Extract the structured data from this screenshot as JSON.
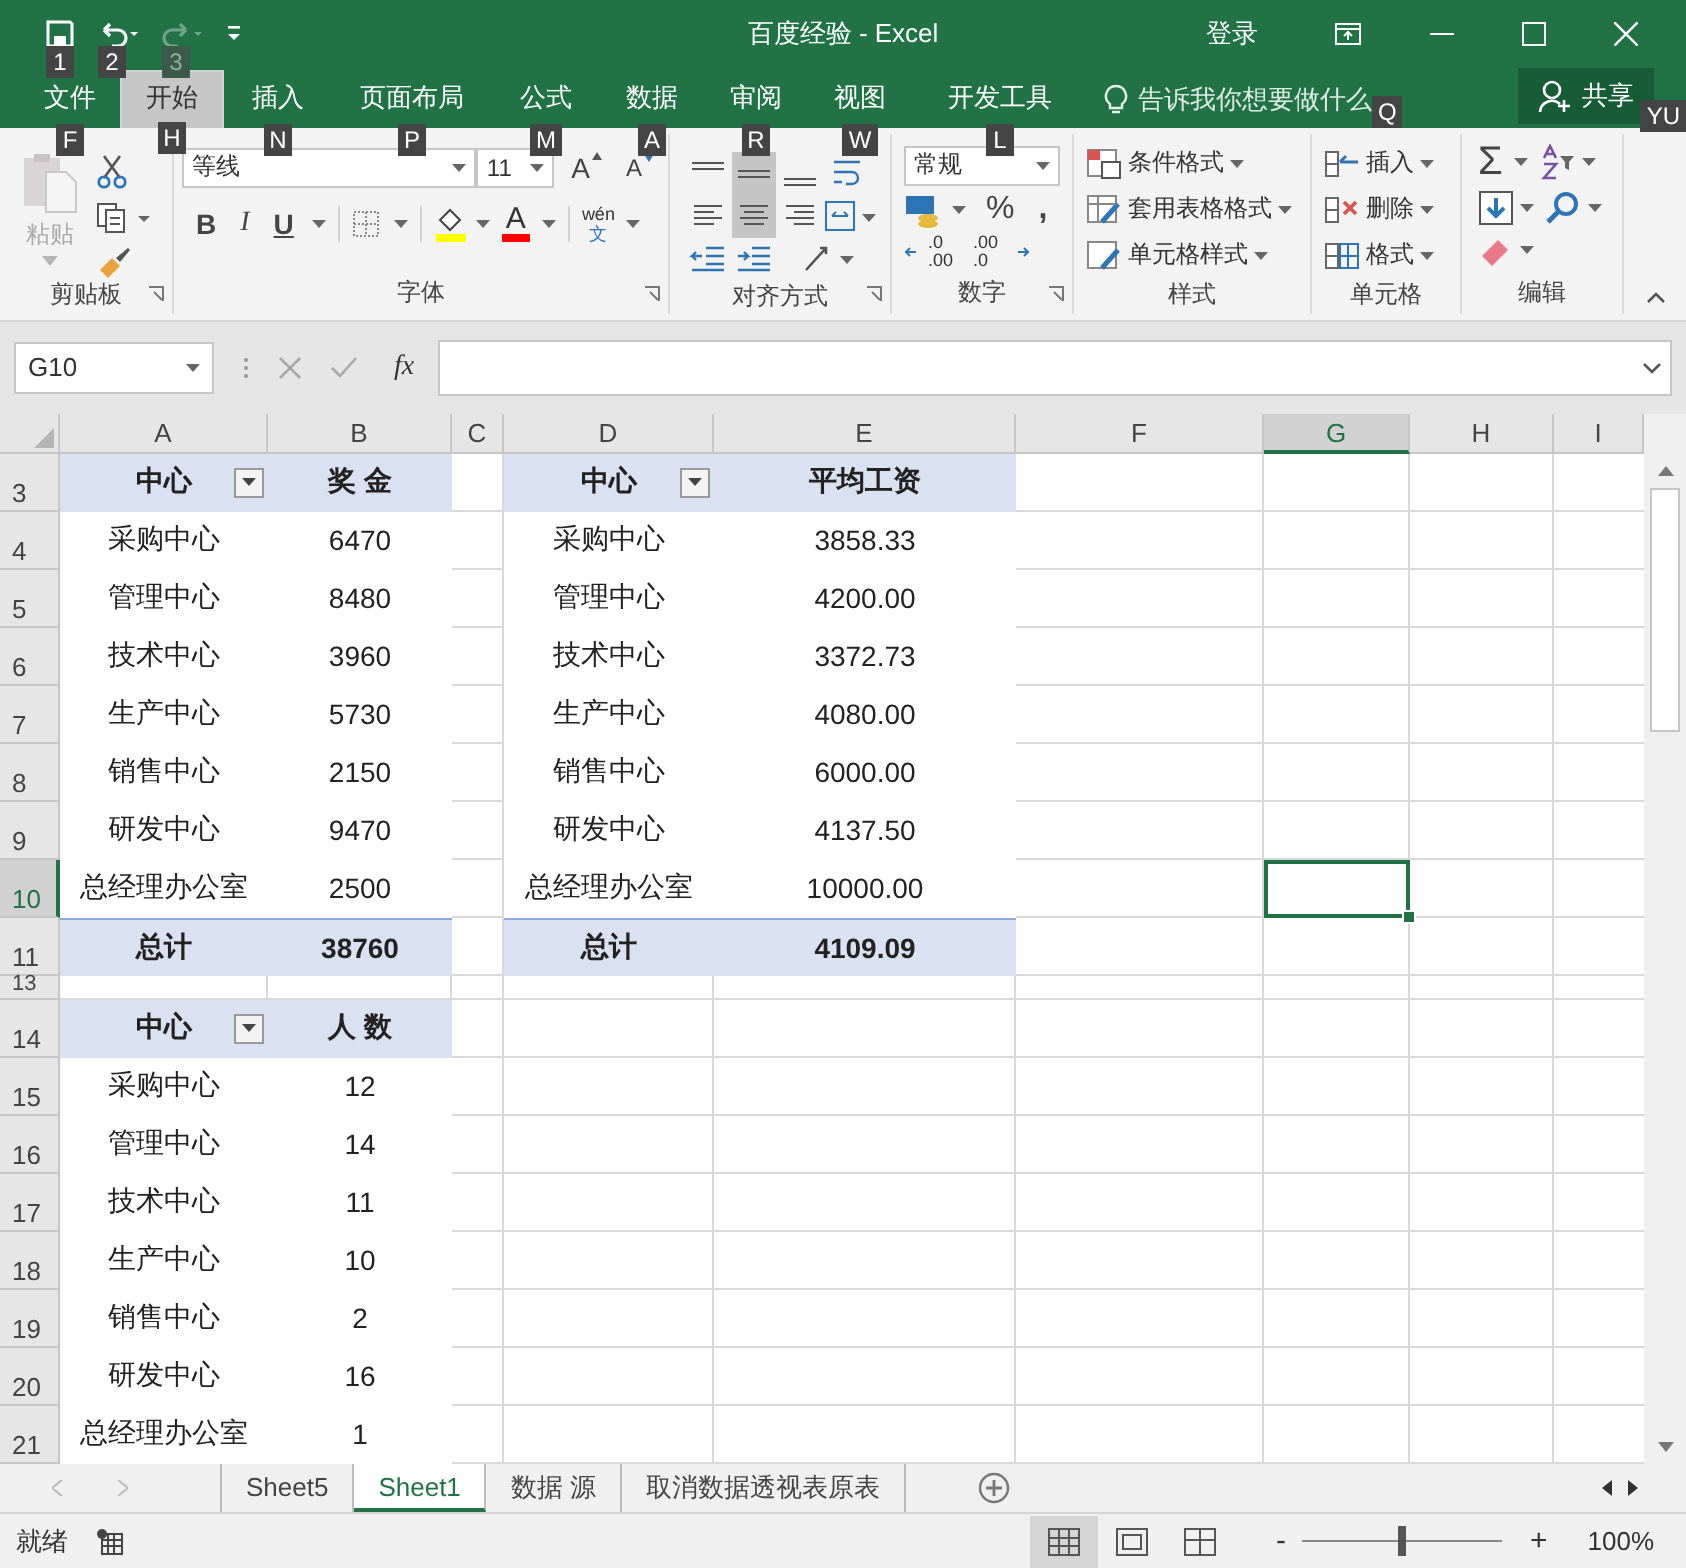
{
  "title_bar": {
    "quick_access": [
      {
        "kind": "save",
        "key_tip": "1",
        "disabled": false
      },
      {
        "kind": "undo",
        "key_tip": "2",
        "disabled": false
      },
      {
        "kind": "redo",
        "key_tip": "3",
        "disabled": true
      }
    ],
    "title": "百度经验  -  Excel",
    "sign_in": "登录"
  },
  "tabs": [
    {
      "label": "文件",
      "key_tip": "F",
      "selected": false
    },
    {
      "label": "开始",
      "key_tip": "H",
      "selected": true
    },
    {
      "label": "插入",
      "key_tip": "N",
      "selected": false
    },
    {
      "label": "页面布局",
      "key_tip": "P",
      "selected": false
    },
    {
      "label": "公式",
      "key_tip": "M",
      "selected": false
    },
    {
      "label": "数据",
      "key_tip": "A",
      "selected": false
    },
    {
      "label": "审阅",
      "key_tip": "R",
      "selected": false
    },
    {
      "label": "视图",
      "key_tip": "W",
      "selected": false
    },
    {
      "label": "开发工具",
      "key_tip": "L",
      "selected": false
    }
  ],
  "tell_me": {
    "label": "告诉我你想要做什么",
    "key_tip": "Q"
  },
  "share": {
    "label": "共享",
    "key_tip": "YU"
  },
  "ribbon": {
    "clipboard": {
      "label": "剪贴板",
      "paste": "粘贴"
    },
    "font": {
      "label": "字体",
      "font_name": "等线",
      "font_size": "11",
      "grow": "A",
      "shrink": "A",
      "bold": "B",
      "italic": "I",
      "underline": "U",
      "font_color": "A",
      "phonetic_top": "wén",
      "phonetic_bottom": "文"
    },
    "alignment": {
      "label": "对齐方式",
      "vertical": [
        {
          "selected": false
        },
        {
          "selected": true
        },
        {
          "selected": false
        }
      ],
      "horizontal": [
        {
          "selected": false
        },
        {
          "selected": true
        },
        {
          "selected": false
        }
      ]
    },
    "number": {
      "label": "数字",
      "format": "常规",
      "percent": "%",
      "comma": ",",
      "increase_decimal": [
        ".0",
        ".00"
      ],
      "decrease_decimal": [
        ".00",
        ".0"
      ]
    },
    "styles": {
      "label": "样式",
      "buttons": [
        "条件格式",
        "套用表格格式",
        "单元格样式"
      ]
    },
    "cells": {
      "label": "单元格",
      "buttons": [
        "插入",
        "删除",
        "格式"
      ]
    },
    "editing": {
      "label": "编辑",
      "sum": "Σ"
    }
  },
  "formula_bar": {
    "name_box": "G10",
    "function_label": "fx"
  },
  "sheet": {
    "columns": [
      {
        "label": "A",
        "selected": false
      },
      {
        "label": "B",
        "selected": false
      },
      {
        "label": "C",
        "selected": false
      },
      {
        "label": "D",
        "selected": false
      },
      {
        "label": "E",
        "selected": false
      },
      {
        "label": "F",
        "selected": false
      },
      {
        "label": "G",
        "selected": true
      },
      {
        "label": "H",
        "selected": false
      },
      {
        "label": "I",
        "selected": false
      }
    ],
    "rows": [
      {
        "number": "3",
        "selected": false,
        "kind": "normal",
        "left": {
          "kind": "header",
          "cells": [
            "中心",
            "奖 金"
          ]
        },
        "right": {
          "kind": "header",
          "cells": [
            "中心",
            "平均工资"
          ]
        }
      },
      {
        "number": "4",
        "selected": false,
        "kind": "normal",
        "left": {
          "kind": "data",
          "cells": [
            "采购中心",
            "6470"
          ]
        },
        "right": {
          "kind": "data",
          "cells": [
            "采购中心",
            "3858.33"
          ]
        }
      },
      {
        "number": "5",
        "selected": false,
        "kind": "normal",
        "left": {
          "kind": "data",
          "cells": [
            "管理中心",
            "8480"
          ]
        },
        "right": {
          "kind": "data",
          "cells": [
            "管理中心",
            "4200.00"
          ]
        }
      },
      {
        "number": "6",
        "selected": false,
        "kind": "normal",
        "left": {
          "kind": "data",
          "cells": [
            "技术中心",
            "3960"
          ]
        },
        "right": {
          "kind": "data",
          "cells": [
            "技术中心",
            "3372.73"
          ]
        }
      },
      {
        "number": "7",
        "selected": false,
        "kind": "normal",
        "left": {
          "kind": "data",
          "cells": [
            "生产中心",
            "5730"
          ]
        },
        "right": {
          "kind": "data",
          "cells": [
            "生产中心",
            "4080.00"
          ]
        }
      },
      {
        "number": "8",
        "selected": false,
        "kind": "normal",
        "left": {
          "kind": "data",
          "cells": [
            "销售中心",
            "2150"
          ]
        },
        "right": {
          "kind": "data",
          "cells": [
            "销售中心",
            "6000.00"
          ]
        }
      },
      {
        "number": "9",
        "selected": false,
        "kind": "normal",
        "left": {
          "kind": "data",
          "cells": [
            "研发中心",
            "9470"
          ]
        },
        "right": {
          "kind": "data",
          "cells": [
            "研发中心",
            "4137.50"
          ]
        }
      },
      {
        "number": "10",
        "selected": true,
        "kind": "normal",
        "left": {
          "kind": "data",
          "cells": [
            "总经理办公室",
            "2500"
          ]
        },
        "right": {
          "kind": "data",
          "cells": [
            "总经理办公室",
            "10000.00"
          ]
        }
      },
      {
        "number": "11",
        "selected": false,
        "kind": "normal",
        "left": {
          "kind": "total",
          "cells": [
            "总计",
            "38760"
          ]
        },
        "right": {
          "kind": "total",
          "cells": [
            "总计",
            "4109.09"
          ]
        }
      },
      {
        "number": "13",
        "selected": false,
        "kind": "short"
      },
      {
        "number": "14",
        "selected": false,
        "kind": "normal",
        "left": {
          "kind": "header",
          "cells": [
            "中心",
            "人 数"
          ]
        }
      },
      {
        "number": "15",
        "selected": false,
        "kind": "normal",
        "left": {
          "kind": "data",
          "cells": [
            "采购中心",
            "12"
          ]
        }
      },
      {
        "number": "16",
        "selected": false,
        "kind": "normal",
        "left": {
          "kind": "data",
          "cells": [
            "管理中心",
            "14"
          ]
        }
      },
      {
        "number": "17",
        "selected": false,
        "kind": "normal",
        "left": {
          "kind": "data",
          "cells": [
            "技术中心",
            "11"
          ]
        }
      },
      {
        "number": "18",
        "selected": false,
        "kind": "normal",
        "left": {
          "kind": "data",
          "cells": [
            "生产中心",
            "10"
          ]
        }
      },
      {
        "number": "19",
        "selected": false,
        "kind": "normal",
        "left": {
          "kind": "data",
          "cells": [
            "销售中心",
            "2"
          ]
        }
      },
      {
        "number": "20",
        "selected": false,
        "kind": "normal",
        "left": {
          "kind": "data",
          "cells": [
            "研发中心",
            "16"
          ]
        }
      },
      {
        "number": "21",
        "selected": false,
        "kind": "normal",
        "left": {
          "kind": "data",
          "cells": [
            "总经理办公室",
            "1"
          ]
        }
      }
    ]
  },
  "sheet_tabs": [
    {
      "label": "Sheet5",
      "selected": false
    },
    {
      "label": "Sheet1",
      "selected": true
    },
    {
      "label": "数据 源",
      "selected": false
    },
    {
      "label": "取消数据透视表原表",
      "selected": false
    }
  ],
  "status_bar": {
    "text": "就绪",
    "views": [
      {
        "kind": "normal",
        "selected": true
      },
      {
        "kind": "page_layout",
        "selected": false
      },
      {
        "kind": "page_break",
        "selected": false
      }
    ],
    "zoom": {
      "minus": "-",
      "plus": "+",
      "level": 0.5,
      "label": "100%"
    }
  }
}
